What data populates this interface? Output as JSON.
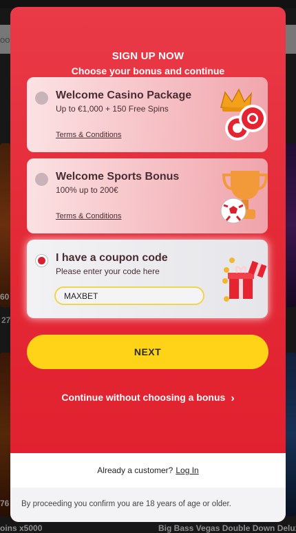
{
  "background": {
    "search_fragment": "ook",
    "left_partial_1": "60",
    "left_partial_2": "27",
    "left_partial_3": "76",
    "bottom_left_label": "oins x5000",
    "bottom_right_label": "Big Bass Vegas Double Down Delux"
  },
  "modal": {
    "title": "SIGN UP NOW",
    "subtitle": "Choose your bonus and continue",
    "options": [
      {
        "title": "Welcome Casino Package",
        "subtitle": "Up to €1,000 + 150 Free Spins",
        "terms": "Terms & Conditions",
        "selected": false,
        "icon": "crown-and-chips-icon"
      },
      {
        "title": "Welcome Sports Bonus",
        "subtitle": "100% up to 200€",
        "terms": "Terms & Conditions",
        "selected": false,
        "icon": "trophy-and-football-icon"
      },
      {
        "title": "I have a coupon code",
        "subtitle": "Please enter your code here",
        "selected": true,
        "icon": "gift-box-icon"
      }
    ],
    "coupon": {
      "value": "MAXBET",
      "placeholder": ""
    },
    "next_label": "NEXT",
    "skip_label": "Continue without choosing a bonus",
    "login_prompt": "Already a customer?",
    "login_link": "Log In",
    "age_notice": "By proceeding you confirm you are 18 years of age or older."
  },
  "colors": {
    "accent_red": "#e42a37",
    "button_yellow": "#ffd318",
    "selected_dot": "#d9202e"
  }
}
